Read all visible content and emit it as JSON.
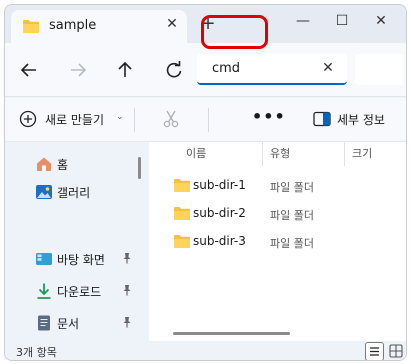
{
  "window": {
    "tab_title": "sample",
    "new_tab_glyph": "+",
    "tab_close_glyph": "✕",
    "minimize_glyph": "—",
    "maximize_glyph": "☐",
    "close_glyph": "✕"
  },
  "navbar": {
    "address_value": "cmd",
    "clear_glyph": "✕"
  },
  "commandbar": {
    "new_label": "새로 만들기",
    "new_chevron": "⌄",
    "more_label": "•••",
    "details_label": "세부 정보"
  },
  "sidebar": {
    "items": [
      {
        "label": "홈",
        "icon": "home-icon",
        "pinned": false
      },
      {
        "label": "갤러리",
        "icon": "gallery-icon",
        "pinned": false
      },
      {
        "label": "바탕 화면",
        "icon": "desktop-icon",
        "pinned": true
      },
      {
        "label": "다운로드",
        "icon": "download-icon",
        "pinned": true
      },
      {
        "label": "문서",
        "icon": "document-icon",
        "pinned": true
      }
    ]
  },
  "filelist": {
    "columns": [
      "이름",
      "유형",
      "크기"
    ],
    "rows": [
      {
        "name": "sub-dir-1",
        "type": "파일 폴더"
      },
      {
        "name": "sub-dir-2",
        "type": "파일 폴더"
      },
      {
        "name": "sub-dir-3",
        "type": "파일 폴더"
      }
    ]
  },
  "status": {
    "item_count": "3개 항목"
  },
  "colors": {
    "accent": "#0067c0",
    "highlight": "#e00000",
    "folder": "#f4c243"
  }
}
